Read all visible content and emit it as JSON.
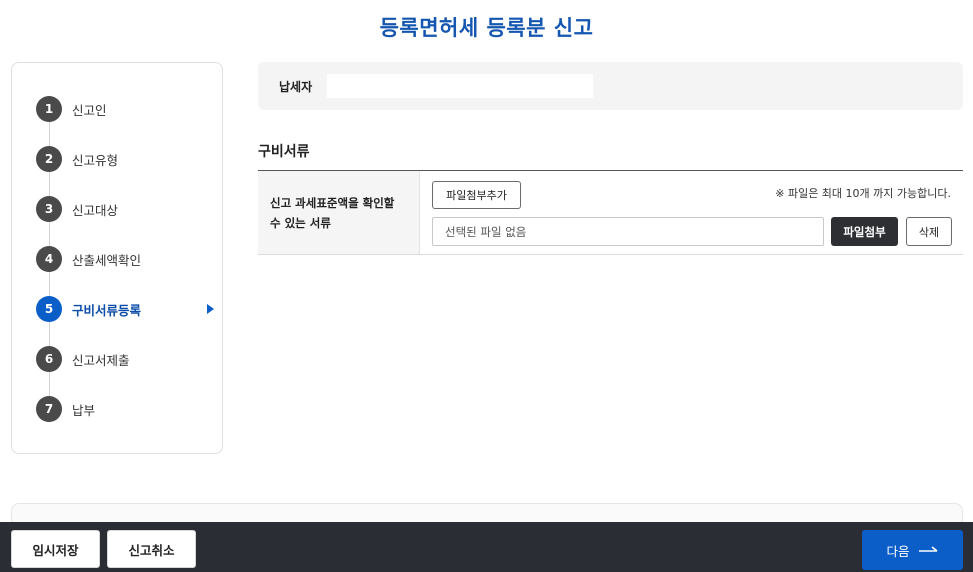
{
  "page_title": "등록면허세 등록분 신고",
  "steps": [
    {
      "num": "1",
      "label": "신고인"
    },
    {
      "num": "2",
      "label": "신고유형"
    },
    {
      "num": "3",
      "label": "신고대상"
    },
    {
      "num": "4",
      "label": "산출세액확인"
    },
    {
      "num": "5",
      "label": "구비서류등록",
      "active": true
    },
    {
      "num": "6",
      "label": "신고서제출"
    },
    {
      "num": "7",
      "label": "납부"
    }
  ],
  "taxpayer": {
    "label": "납세자",
    "value": ""
  },
  "documents": {
    "section_title": "구비서류",
    "row_label_line1": "신고 과세표준액을 확인할",
    "row_label_line2": "수 있는 서류",
    "add_file_label": "파일첨부추가",
    "limit_note": "※ 파일은 최대 10개 까지 가능합니다.",
    "file_placeholder": "선택된 파일 없음",
    "attach_label": "파일첨부",
    "delete_label": "삭제"
  },
  "footer": {
    "temp_save_label": "임시저장",
    "cancel_label": "신고취소",
    "next_label": "다음"
  },
  "colors": {
    "accent": "#0b5dc8",
    "title": "#1557b0",
    "footer_bg": "#2a2d33",
    "dark_button": "#2d2f33"
  },
  "icons": {
    "active_step": "triangle-right-icon",
    "next": "arrow-right-icon"
  }
}
